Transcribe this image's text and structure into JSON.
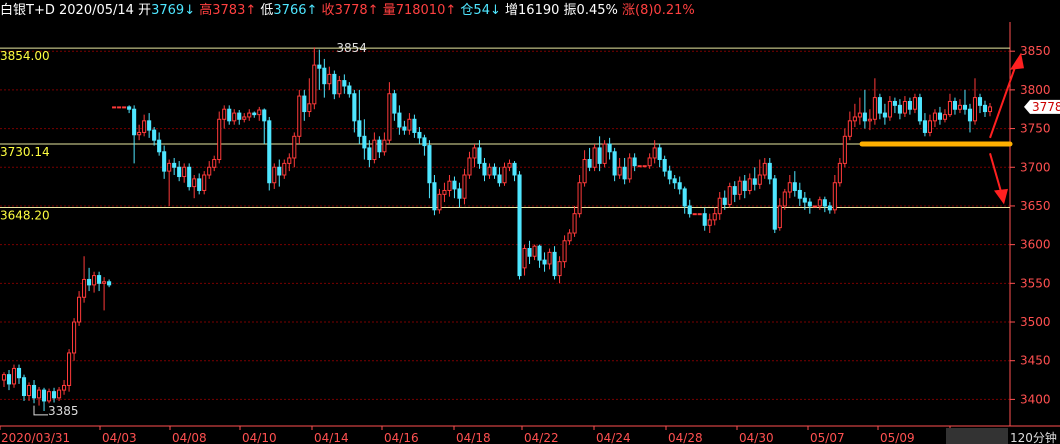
{
  "header": {
    "symbol": "白银T+D",
    "date": "2020/05/14",
    "open_label": "开",
    "open": "3769",
    "high_label": "高",
    "high": "3783",
    "low_label": "低",
    "low": "3766",
    "close_label": "收",
    "close": "3778",
    "volume_label": "量",
    "volume": "718010",
    "position_label": "仓",
    "position": "54",
    "increase_label": "增",
    "increase": "16190",
    "amplitude_label": "振",
    "amplitude": "0.45%",
    "change_label": "涨",
    "change": "(8)0.21%"
  },
  "colors": {
    "up": "#ff3a3a",
    "down": "#4fe6ff",
    "ref": "#ffff40",
    "trend": "#ffb000",
    "grid": "#7a0000",
    "axis": "#ff5050"
  },
  "period_label": "120分钟",
  "current_price_tag": "3778",
  "chart_data": {
    "type": "candlestick",
    "ylim": [
      3380,
      3870
    ],
    "yticks": [
      3400,
      3450,
      3500,
      3550,
      3600,
      3650,
      3700,
      3750,
      3800,
      3850
    ],
    "x_labels": [
      "2020/03/31",
      "04/03",
      "04/08",
      "04/10",
      "04/14",
      "04/16",
      "04/18",
      "04/22",
      "04/24",
      "04/28",
      "04/30",
      "05/07",
      "05/09",
      "05/13"
    ],
    "reference_lines": [
      {
        "label": "3854.00",
        "value": 3854
      },
      {
        "label": "3730.14",
        "value": 3730
      },
      {
        "label": "3648.20",
        "value": 3648
      }
    ],
    "annotations": [
      {
        "text": "3854",
        "value": 3854
      },
      {
        "text": "3385",
        "value": 3385
      }
    ],
    "trend_line_value": 3730,
    "candles": [
      [
        3425,
        3432,
        3416,
        3435
      ],
      [
        3432,
        3420,
        3412,
        3438
      ],
      [
        3420,
        3440,
        3415,
        3445
      ],
      [
        3440,
        3428,
        3420,
        3445
      ],
      [
        3428,
        3405,
        3398,
        3432
      ],
      [
        3405,
        3418,
        3398,
        3422
      ],
      [
        3418,
        3402,
        3395,
        3425
      ],
      [
        3402,
        3412,
        3392,
        3416
      ],
      [
        3412,
        3398,
        3385,
        3415
      ],
      [
        3398,
        3410,
        3395,
        3414
      ],
      [
        3410,
        3402,
        3396,
        3415
      ],
      [
        3402,
        3412,
        3398,
        3416
      ],
      [
        3412,
        3418,
        3406,
        3425
      ],
      [
        3418,
        3460,
        3410,
        3465
      ],
      [
        3460,
        3500,
        3450,
        3505
      ],
      [
        3500,
        3532,
        3495,
        3540
      ],
      [
        3532,
        3555,
        3525,
        3585
      ],
      [
        3555,
        3548,
        3540,
        3570
      ],
      [
        3548,
        3560,
        3538,
        3565
      ],
      [
        3560,
        3550,
        3540,
        3565
      ],
      [
        3550,
        3552,
        3515,
        3558
      ],
      [
        3552,
        3548,
        3545,
        3555
      ],
      [
        3778,
        3778,
        3778,
        3778
      ],
      [
        3778,
        3778,
        3778,
        3778
      ],
      [
        3778,
        3778,
        3778,
        3778
      ],
      [
        3778,
        3775,
        3770,
        3780
      ],
      [
        3775,
        3742,
        3705,
        3780
      ],
      [
        3742,
        3745,
        3735,
        3755
      ],
      [
        3745,
        3760,
        3740,
        3768
      ],
      [
        3760,
        3748,
        3738,
        3770
      ],
      [
        3748,
        3735,
        3728,
        3752
      ],
      [
        3735,
        3720,
        3715,
        3745
      ],
      [
        3720,
        3695,
        3685,
        3728
      ],
      [
        3695,
        3705,
        3650,
        3710
      ],
      [
        3705,
        3700,
        3690,
        3712
      ],
      [
        3700,
        3688,
        3682,
        3708
      ],
      [
        3688,
        3700,
        3680,
        3705
      ],
      [
        3700,
        3675,
        3670,
        3705
      ],
      [
        3675,
        3685,
        3660,
        3690
      ],
      [
        3685,
        3670,
        3665,
        3692
      ],
      [
        3670,
        3690,
        3665,
        3695
      ],
      [
        3690,
        3700,
        3685,
        3708
      ],
      [
        3700,
        3710,
        3695,
        3715
      ],
      [
        3710,
        3762,
        3705,
        3772
      ],
      [
        3762,
        3775,
        3750,
        3780
      ],
      [
        3775,
        3760,
        3755,
        3780
      ],
      [
        3760,
        3770,
        3755,
        3775
      ],
      [
        3770,
        3762,
        3755,
        3774
      ],
      [
        3762,
        3765,
        3758,
        3770
      ],
      [
        3765,
        3770,
        3760,
        3775
      ],
      [
        3770,
        3768,
        3764,
        3772
      ],
      [
        3768,
        3774,
        3760,
        3778
      ],
      [
        3774,
        3760,
        3730,
        3776
      ],
      [
        3760,
        3680,
        3670,
        3765
      ],
      [
        3680,
        3700,
        3672,
        3705
      ],
      [
        3700,
        3690,
        3675,
        3710
      ],
      [
        3690,
        3705,
        3685,
        3710
      ],
      [
        3705,
        3712,
        3695,
        3718
      ],
      [
        3712,
        3740,
        3700,
        3745
      ],
      [
        3740,
        3792,
        3730,
        3800
      ],
      [
        3792,
        3772,
        3760,
        3800
      ],
      [
        3772,
        3782,
        3765,
        3815
      ],
      [
        3782,
        3832,
        3775,
        3855
      ],
      [
        3832,
        3828,
        3800,
        3852
      ],
      [
        3828,
        3808,
        3790,
        3840
      ],
      [
        3808,
        3820,
        3800,
        3830
      ],
      [
        3820,
        3795,
        3788,
        3825
      ],
      [
        3795,
        3812,
        3790,
        3818
      ],
      [
        3812,
        3805,
        3795,
        3820
      ],
      [
        3805,
        3795,
        3790,
        3810
      ],
      [
        3795,
        3760,
        3745,
        3800
      ],
      [
        3760,
        3740,
        3730,
        3800
      ],
      [
        3740,
        3725,
        3710,
        3762
      ],
      [
        3725,
        3710,
        3700,
        3735
      ],
      [
        3710,
        3735,
        3705,
        3745
      ],
      [
        3735,
        3720,
        3712,
        3740
      ],
      [
        3720,
        3735,
        3715,
        3745
      ],
      [
        3735,
        3795,
        3730,
        3810
      ],
      [
        3795,
        3770,
        3760,
        3800
      ],
      [
        3770,
        3752,
        3742,
        3780
      ],
      [
        3752,
        3748,
        3742,
        3760
      ],
      [
        3748,
        3762,
        3742,
        3770
      ],
      [
        3762,
        3745,
        3738,
        3768
      ],
      [
        3745,
        3738,
        3730,
        3752
      ],
      [
        3738,
        3728,
        3715,
        3742
      ],
      [
        3728,
        3680,
        3660,
        3735
      ],
      [
        3680,
        3645,
        3638,
        3690
      ],
      [
        3645,
        3665,
        3640,
        3672
      ],
      [
        3665,
        3670,
        3655,
        3680
      ],
      [
        3670,
        3682,
        3662,
        3690
      ],
      [
        3682,
        3672,
        3660,
        3688
      ],
      [
        3672,
        3660,
        3648,
        3680
      ],
      [
        3660,
        3690,
        3652,
        3698
      ],
      [
        3690,
        3712,
        3685,
        3720
      ],
      [
        3712,
        3725,
        3700,
        3730
      ],
      [
        3725,
        3705,
        3698,
        3735
      ],
      [
        3705,
        3690,
        3682,
        3712
      ],
      [
        3690,
        3700,
        3685,
        3705
      ],
      [
        3700,
        3690,
        3685,
        3705
      ],
      [
        3690,
        3680,
        3675,
        3700
      ],
      [
        3680,
        3700,
        3676,
        3706
      ],
      [
        3700,
        3705,
        3695,
        3710
      ],
      [
        3705,
        3690,
        3682,
        3708
      ],
      [
        3690,
        3560,
        3555,
        3695
      ],
      [
        3570,
        3595,
        3560,
        3600
      ],
      [
        3595,
        3585,
        3575,
        3605
      ],
      [
        3585,
        3598,
        3580,
        3600
      ],
      [
        3598,
        3580,
        3570,
        3600
      ],
      [
        3580,
        3575,
        3565,
        3590
      ],
      [
        3575,
        3590,
        3568,
        3595
      ],
      [
        3590,
        3560,
        3555,
        3598
      ],
      [
        3560,
        3578,
        3550,
        3585
      ],
      [
        3578,
        3605,
        3570,
        3612
      ],
      [
        3605,
        3615,
        3600,
        3620
      ],
      [
        3615,
        3640,
        3610,
        3650
      ],
      [
        3640,
        3680,
        3635,
        3690
      ],
      [
        3680,
        3710,
        3675,
        3722
      ],
      [
        3710,
        3700,
        3695,
        3725
      ],
      [
        3700,
        3725,
        3695,
        3730
      ],
      [
        3725,
        3705,
        3695,
        3740
      ],
      [
        3705,
        3730,
        3700,
        3735
      ],
      [
        3730,
        3720,
        3710,
        3738
      ],
      [
        3720,
        3690,
        3682,
        3725
      ],
      [
        3690,
        3700,
        3685,
        3712
      ],
      [
        3700,
        3685,
        3678,
        3712
      ],
      [
        3685,
        3712,
        3680,
        3718
      ],
      [
        3712,
        3702,
        3695,
        3718
      ],
      [
        3702,
        3702,
        3702,
        3702
      ],
      [
        3702,
        3702,
        3702,
        3702
      ],
      [
        3702,
        3712,
        3698,
        3718
      ],
      [
        3712,
        3725,
        3705,
        3735
      ],
      [
        3725,
        3710,
        3700,
        3730
      ],
      [
        3710,
        3695,
        3688,
        3715
      ],
      [
        3695,
        3685,
        3678,
        3702
      ],
      [
        3685,
        3680,
        3672,
        3690
      ],
      [
        3680,
        3672,
        3665,
        3688
      ],
      [
        3672,
        3650,
        3640,
        3675
      ],
      [
        3650,
        3640,
        3635,
        3658
      ],
      [
        3640,
        3640,
        3640,
        3640
      ],
      [
        3640,
        3640,
        3640,
        3640
      ],
      [
        3640,
        3625,
        3618,
        3648
      ],
      [
        3625,
        3632,
        3615,
        3640
      ],
      [
        3632,
        3640,
        3625,
        3648
      ],
      [
        3640,
        3660,
        3632,
        3668
      ],
      [
        3660,
        3652,
        3645,
        3670
      ],
      [
        3652,
        3675,
        3648,
        3680
      ],
      [
        3675,
        3665,
        3655,
        3682
      ],
      [
        3665,
        3682,
        3658,
        3688
      ],
      [
        3682,
        3670,
        3660,
        3690
      ],
      [
        3670,
        3685,
        3665,
        3692
      ],
      [
        3685,
        3678,
        3670,
        3700
      ],
      [
        3678,
        3690,
        3672,
        3710
      ],
      [
        3690,
        3705,
        3685,
        3712
      ],
      [
        3705,
        3685,
        3678,
        3712
      ],
      [
        3685,
        3620,
        3615,
        3690
      ],
      [
        3622,
        3650,
        3618,
        3660
      ],
      [
        3650,
        3668,
        3645,
        3672
      ],
      [
        3668,
        3680,
        3660,
        3690
      ],
      [
        3680,
        3670,
        3662,
        3695
      ],
      [
        3670,
        3660,
        3650,
        3680
      ],
      [
        3660,
        3655,
        3645,
        3668
      ],
      [
        3655,
        3650,
        3640,
        3660
      ],
      [
        3650,
        3650,
        3650,
        3650
      ],
      [
        3650,
        3658,
        3645,
        3662
      ],
      [
        3658,
        3650,
        3642,
        3662
      ],
      [
        3650,
        3645,
        3640,
        3655
      ],
      [
        3645,
        3680,
        3640,
        3690
      ],
      [
        3680,
        3705,
        3675,
        3712
      ],
      [
        3705,
        3740,
        3700,
        3750
      ],
      [
        3740,
        3760,
        3735,
        3772
      ],
      [
        3760,
        3765,
        3752,
        3782
      ],
      [
        3765,
        3770,
        3755,
        3790
      ],
      [
        3770,
        3760,
        3750,
        3800
      ],
      [
        3760,
        3762,
        3748,
        3775
      ],
      [
        3762,
        3790,
        3755,
        3815
      ],
      [
        3790,
        3770,
        3762,
        3795
      ],
      [
        3770,
        3765,
        3755,
        3782
      ],
      [
        3765,
        3785,
        3760,
        3792
      ],
      [
        3785,
        3780,
        3770,
        3790
      ],
      [
        3780,
        3770,
        3762,
        3788
      ],
      [
        3770,
        3785,
        3765,
        3792
      ],
      [
        3785,
        3775,
        3768,
        3790
      ],
      [
        3775,
        3790,
        3770,
        3795
      ],
      [
        3790,
        3760,
        3755,
        3795
      ],
      [
        3760,
        3745,
        3740,
        3770
      ],
      [
        3745,
        3760,
        3740,
        3768
      ],
      [
        3760,
        3770,
        3752,
        3775
      ],
      [
        3770,
        3762,
        3755,
        3778
      ],
      [
        3762,
        3768,
        3758,
        3775
      ],
      [
        3768,
        3785,
        3765,
        3795
      ],
      [
        3785,
        3775,
        3768,
        3790
      ],
      [
        3775,
        3780,
        3770,
        3788
      ],
      [
        3780,
        3775,
        3768,
        3800
      ],
      [
        3775,
        3760,
        3745,
        3782
      ],
      [
        3760,
        3790,
        3755,
        3815
      ],
      [
        3790,
        3780,
        3770,
        3795
      ],
      [
        3780,
        3772,
        3765,
        3786
      ],
      [
        3772,
        3778,
        3766,
        3783
      ]
    ]
  }
}
